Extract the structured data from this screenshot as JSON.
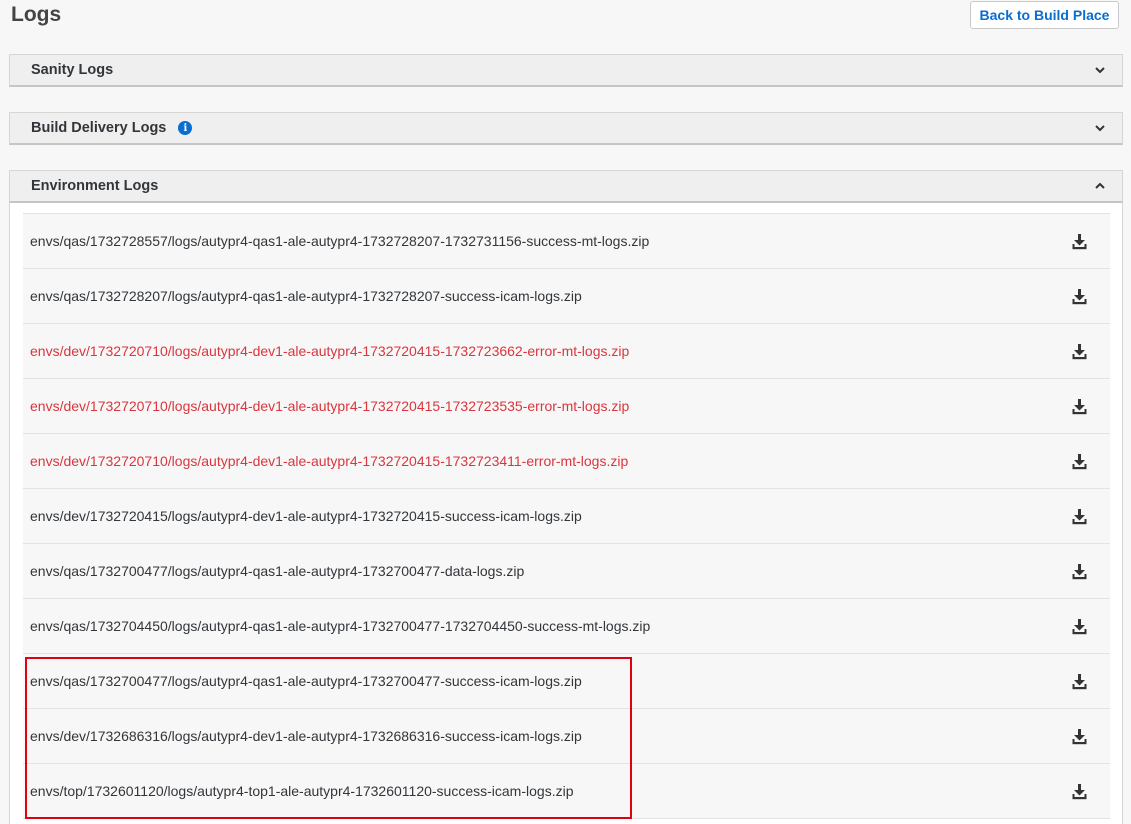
{
  "page": {
    "title": "Logs",
    "back_label": "Back to Build Place"
  },
  "sections": {
    "sanity": {
      "label": "Sanity Logs"
    },
    "delivery": {
      "label": "Build Delivery Logs"
    },
    "environment": {
      "label": "Environment Logs"
    }
  },
  "files": [
    {
      "name": "envs/qas/1732728557/logs/autypr4-qas1-ale-autypr4-1732728207-1732731156-success-mt-logs.zip",
      "status": "success"
    },
    {
      "name": "envs/qas/1732728207/logs/autypr4-qas1-ale-autypr4-1732728207-success-icam-logs.zip",
      "status": "success"
    },
    {
      "name": "envs/dev/1732720710/logs/autypr4-dev1-ale-autypr4-1732720415-1732723662-error-mt-logs.zip",
      "status": "error"
    },
    {
      "name": "envs/dev/1732720710/logs/autypr4-dev1-ale-autypr4-1732720415-1732723535-error-mt-logs.zip",
      "status": "error"
    },
    {
      "name": "envs/dev/1732720710/logs/autypr4-dev1-ale-autypr4-1732720415-1732723411-error-mt-logs.zip",
      "status": "error"
    },
    {
      "name": "envs/dev/1732720415/logs/autypr4-dev1-ale-autypr4-1732720415-success-icam-logs.zip",
      "status": "success"
    },
    {
      "name": "envs/qas/1732700477/logs/autypr4-qas1-ale-autypr4-1732700477-data-logs.zip",
      "status": "success"
    },
    {
      "name": "envs/qas/1732704450/logs/autypr4-qas1-ale-autypr4-1732700477-1732704450-success-mt-logs.zip",
      "status": "success"
    },
    {
      "name": "envs/qas/1732700477/logs/autypr4-qas1-ale-autypr4-1732700477-success-icam-logs.zip",
      "status": "success"
    },
    {
      "name": "envs/dev/1732686316/logs/autypr4-dev1-ale-autypr4-1732686316-success-icam-logs.zip",
      "status": "success"
    },
    {
      "name": "envs/top/1732601120/logs/autypr4-top1-ale-autypr4-1732601120-success-icam-logs.zip",
      "status": "success"
    }
  ],
  "icons": {
    "section_collapsed": "chevron-down-icon",
    "section_expanded": "chevron-up-icon",
    "info": "info-icon",
    "download": "download-icon"
  },
  "colors": {
    "link_blue": "#0a6ed1",
    "error_red": "#d9363e",
    "highlight_red": "#e0000f",
    "text": "#32363a"
  }
}
